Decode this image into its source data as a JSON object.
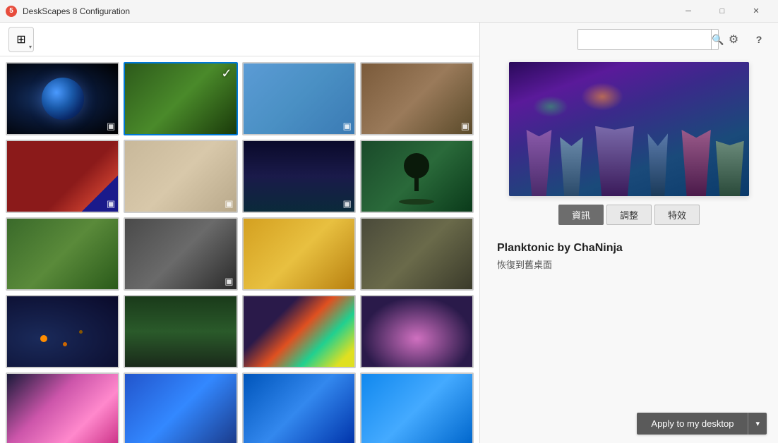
{
  "app": {
    "title": "DeskScapes 8 Configuration",
    "icon": "5"
  },
  "titlebar": {
    "minimize_label": "─",
    "maximize_label": "□",
    "close_label": "✕"
  },
  "toolbar": {
    "view_icon": "⊞",
    "dropdown_arrow": "▾"
  },
  "search": {
    "placeholder": "",
    "search_icon": "🔍",
    "settings_icon": "⚙",
    "help_icon": "?"
  },
  "wallpapers": [
    {
      "id": 1,
      "class": "thumb-1",
      "has_film": true,
      "selected": false
    },
    {
      "id": 2,
      "class": "thumb-2",
      "has_film": false,
      "selected": true
    },
    {
      "id": 3,
      "class": "thumb-3",
      "has_film": true,
      "selected": false
    },
    {
      "id": 4,
      "class": "thumb-4",
      "has_film": true,
      "selected": false
    },
    {
      "id": 5,
      "class": "thumb-5",
      "has_film": true,
      "selected": false
    },
    {
      "id": 6,
      "class": "thumb-6",
      "has_film": true,
      "selected": false
    },
    {
      "id": 7,
      "class": "thumb-7",
      "has_film": true,
      "selected": false
    },
    {
      "id": 8,
      "class": "thumb-8",
      "has_film": false,
      "selected": false
    },
    {
      "id": 9,
      "class": "thumb-9",
      "has_film": false,
      "selected": false
    },
    {
      "id": 10,
      "class": "thumb-10",
      "has_film": false,
      "selected": false
    },
    {
      "id": 11,
      "class": "thumb-11",
      "has_film": false,
      "selected": false
    },
    {
      "id": 12,
      "class": "thumb-12",
      "has_film": false,
      "selected": false
    },
    {
      "id": 13,
      "class": "thumb-13",
      "has_film": false,
      "selected": false
    },
    {
      "id": 14,
      "class": "thumb-14",
      "has_film": false,
      "selected": false
    },
    {
      "id": 15,
      "class": "thumb-15",
      "has_film": false,
      "selected": false
    },
    {
      "id": 16,
      "class": "thumb-16",
      "has_film": false,
      "selected": false
    },
    {
      "id": 17,
      "class": "thumb-17",
      "has_film": false,
      "selected": false
    },
    {
      "id": 18,
      "class": "thumb-18",
      "has_film": false,
      "selected": false
    },
    {
      "id": 19,
      "class": "thumb-19",
      "has_film": false,
      "selected": false
    },
    {
      "id": 20,
      "class": "thumb-20",
      "has_film": false,
      "selected": false
    }
  ],
  "preview": {
    "title": "Planktonic by ChaNinja",
    "subtitle": "恢復到舊桌面"
  },
  "tabs": [
    {
      "id": "info",
      "label": "資訊",
      "active": true
    },
    {
      "id": "adjust",
      "label": "調整",
      "active": false
    },
    {
      "id": "effects",
      "label": "特效",
      "active": false
    }
  ],
  "apply_button": {
    "main_label": "Apply to my desktop",
    "dropdown_arrow": "▾"
  }
}
